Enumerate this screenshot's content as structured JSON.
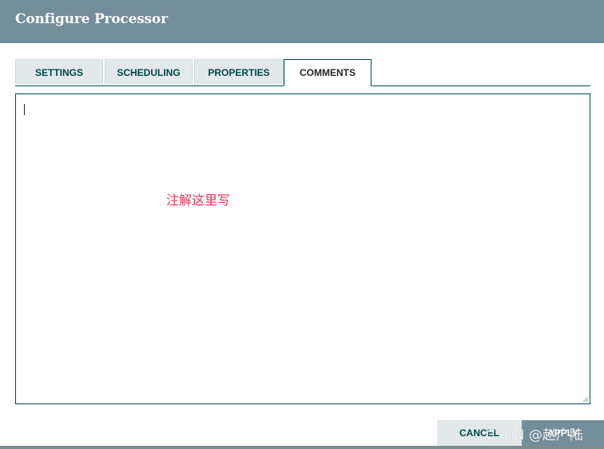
{
  "dialog": {
    "title": "Configure Processor"
  },
  "tabs": [
    {
      "label": "SETTINGS",
      "active": false
    },
    {
      "label": "SCHEDULING",
      "active": false
    },
    {
      "label": "PROPERTIES",
      "active": false
    },
    {
      "label": "COMMENTS",
      "active": true
    }
  ],
  "comments": {
    "value": "",
    "annotation": "注解这里写"
  },
  "buttons": {
    "cancel": "CANCEL",
    "apply": "APPLY"
  },
  "watermark": "CSDN @赵广陆",
  "colors": {
    "header": "#728e9b",
    "accent": "#004849",
    "annotation": "#e8355a"
  }
}
